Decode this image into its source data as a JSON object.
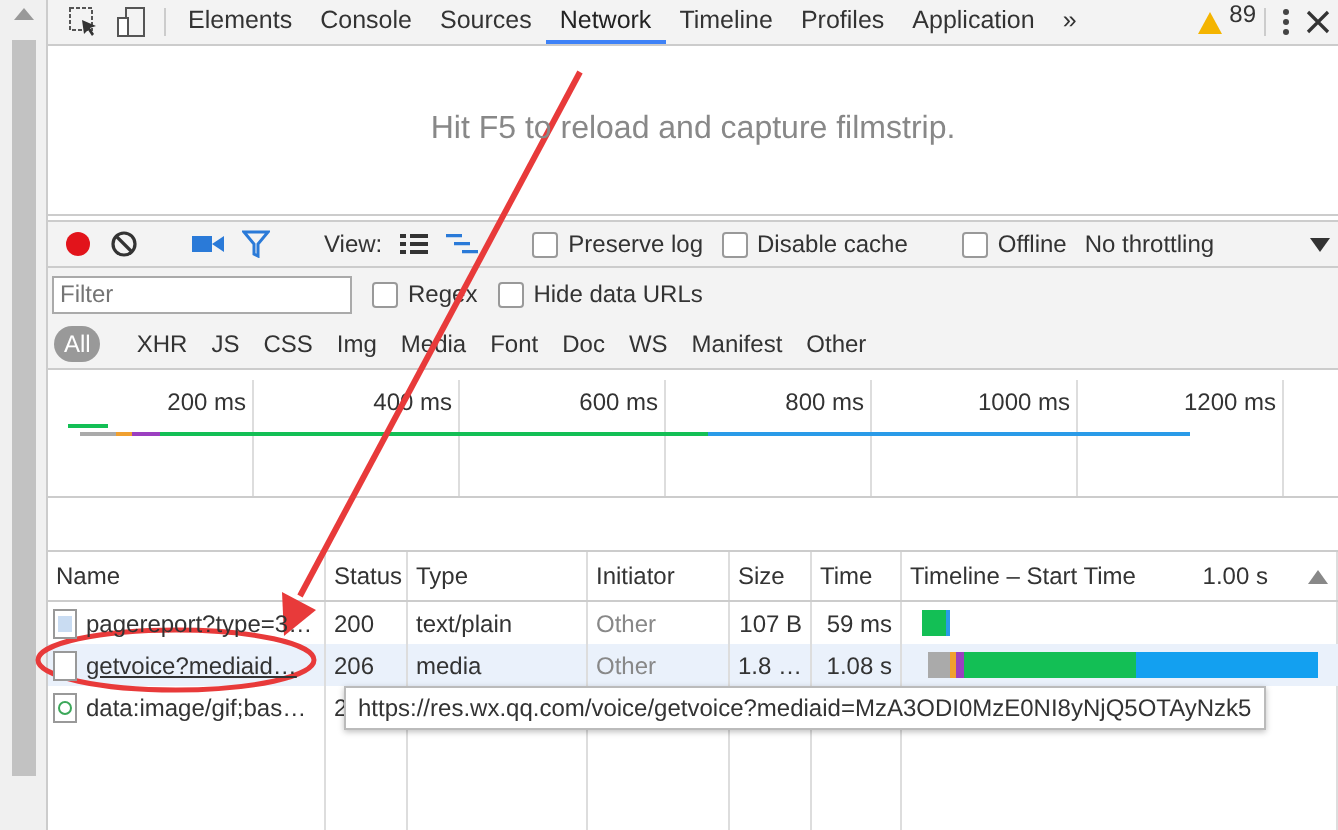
{
  "tabs": [
    {
      "label": "Elements",
      "selected": false
    },
    {
      "label": "Console",
      "selected": false
    },
    {
      "label": "Sources",
      "selected": false
    },
    {
      "label": "Network",
      "selected": true
    },
    {
      "label": "Timeline",
      "selected": false
    },
    {
      "label": "Profiles",
      "selected": false
    },
    {
      "label": "Application",
      "selected": false
    }
  ],
  "more_tabs": "»",
  "warnings": "89",
  "filmstrip_hint": "Hit F5 to reload and capture filmstrip.",
  "toolbar": {
    "view_label": "View:",
    "checkboxes": [
      {
        "label": "Preserve log",
        "checked": false
      },
      {
        "label": "Disable cache",
        "checked": false
      },
      {
        "label": "Offline",
        "checked": false
      }
    ],
    "throttling": "No throttling"
  },
  "filter": {
    "placeholder": "Filter",
    "checkboxes": [
      {
        "label": "Regex",
        "checked": false
      },
      {
        "label": "Hide data URLs",
        "checked": false
      }
    ]
  },
  "types": [
    {
      "label": "All",
      "selected": true
    },
    {
      "label": "XHR",
      "selected": false
    },
    {
      "label": "JS",
      "selected": false
    },
    {
      "label": "CSS",
      "selected": false
    },
    {
      "label": "Img",
      "selected": false
    },
    {
      "label": "Media",
      "selected": false
    },
    {
      "label": "Font",
      "selected": false
    },
    {
      "label": "Doc",
      "selected": false
    },
    {
      "label": "WS",
      "selected": false
    },
    {
      "label": "Manifest",
      "selected": false
    },
    {
      "label": "Other",
      "selected": false
    }
  ],
  "overview_ticks": [
    "200 ms",
    "400 ms",
    "600 ms",
    "800 ms",
    "1000 ms",
    "1200 ms"
  ],
  "table": {
    "columns": [
      "Name",
      "Status",
      "Type",
      "Initiator",
      "Size",
      "Time",
      "Timeline – Start Time"
    ],
    "timeline_scale": "1.00 s",
    "rows": [
      {
        "kind": "document",
        "name": "pagereport?type=3…",
        "status": "200",
        "type": "text/plain",
        "initiator": "Other",
        "size": "107 B",
        "time": "59 ms",
        "hovered": false
      },
      {
        "kind": "blank",
        "name": "getvoice?mediaid…",
        "status": "206",
        "type": "media",
        "initiator": "Other",
        "size": "1.8 …",
        "time": "1.08 s",
        "hovered": true
      },
      {
        "kind": "image",
        "name": "data:image/gif;bas…",
        "status": "2"
      }
    ]
  },
  "tooltip": "https://res.wx.qq.com/voice/getvoice?mediaid=MzA3ODI0MzE0NI8yNjQ5OTAyNzk5"
}
